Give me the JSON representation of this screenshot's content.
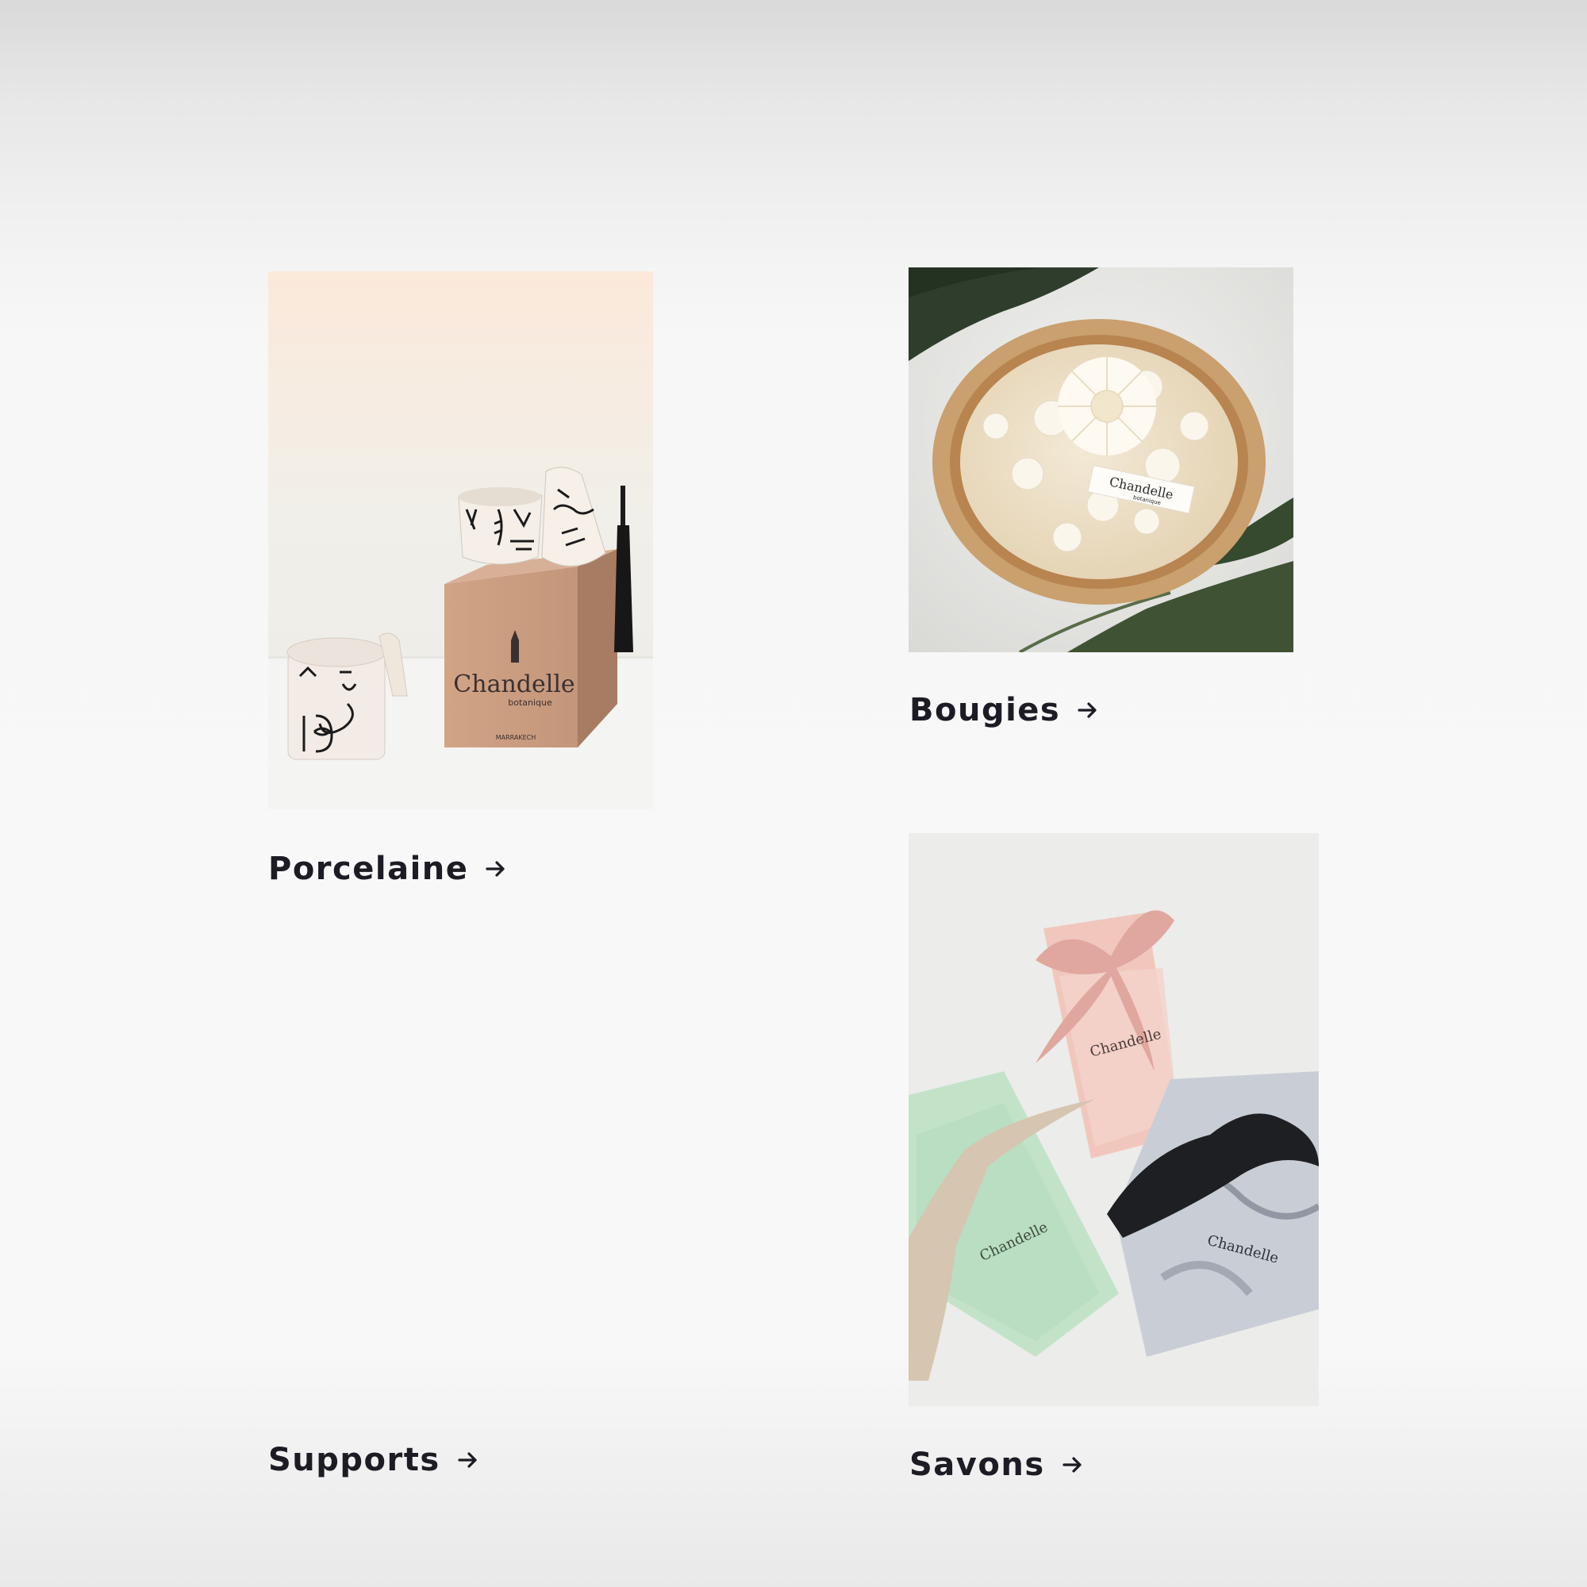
{
  "categories": [
    {
      "key": "porcelaine",
      "label": "Porcelaine"
    },
    {
      "key": "bougies",
      "label": "Bougies"
    },
    {
      "key": "supports",
      "label": "Supports"
    },
    {
      "key": "savons",
      "label": "Savons"
    }
  ],
  "brand": {
    "logo_text": "Chandelle",
    "logo_subtext": "botanique",
    "box_city": "MARRAKECH"
  },
  "icons": {
    "arrow": "arrow-right-icon"
  },
  "colors": {
    "text": "#1d1b24",
    "bow_pink": "#e4b1ab",
    "bow_black": "#1d1d1f",
    "bow_beige": "#d9c7b2",
    "soap_green": "#bfe1c5",
    "soap_marble": "#b8bec8"
  }
}
